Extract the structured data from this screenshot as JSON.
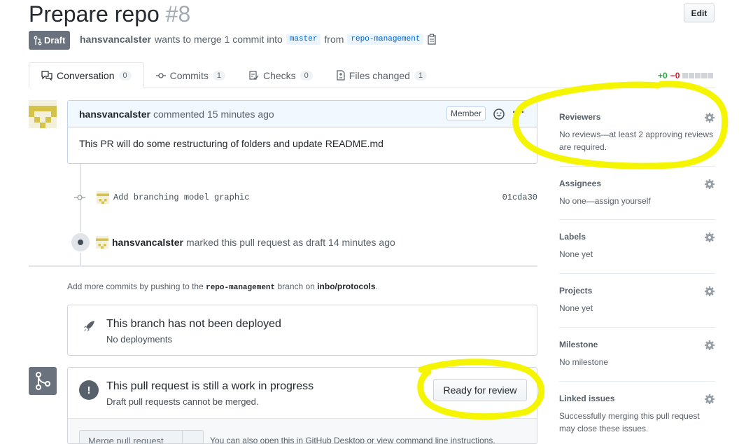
{
  "pr": {
    "title": "Prepare repo",
    "number": "#8",
    "edit_label": "Edit",
    "draft_label": "Draft",
    "author": "hansvancalster",
    "merge_text": "wants to merge 1 commit into",
    "base_branch": "master",
    "from_text": "from",
    "head_branch": "repo-management"
  },
  "tabs": [
    {
      "label": "Conversation",
      "count": "0",
      "icon": "comment-discussion-icon"
    },
    {
      "label": "Commits",
      "count": "1",
      "icon": "git-commit-icon"
    },
    {
      "label": "Checks",
      "count": "0",
      "icon": "checklist-icon"
    },
    {
      "label": "Files changed",
      "count": "1",
      "icon": "file-diff-icon"
    }
  ],
  "diffstat": {
    "additions": "+0",
    "deletions": "−0"
  },
  "comment": {
    "author": "hansvancalster",
    "action": "commented 15 minutes ago",
    "role": "Member",
    "body": "This PR will do some restructuring of folders and update README.md"
  },
  "commit": {
    "message": "Add branching model graphic",
    "sha": "01cda30"
  },
  "draft_event": {
    "author": "hansvancalster",
    "text": "marked this pull request as draft 14 minutes ago"
  },
  "push_note": {
    "prefix": "Add more commits by pushing to the",
    "branch": "repo-management",
    "middle": "branch on",
    "repo": "inbo/protocols",
    "suffix": "."
  },
  "deploy": {
    "title": "This branch has not been deployed",
    "subtitle": "No deployments"
  },
  "wip": {
    "title": "This pull request is still a work in progress",
    "subtitle": "Draft pull requests cannot be merged.",
    "ready_label": "Ready for review",
    "merge_label": "Merge pull request",
    "desktop_note": "You can also open this in GitHub Desktop or view command line instructions."
  },
  "sidebar": {
    "reviewers": {
      "title": "Reviewers",
      "text": "No reviews—at least 2 approving reviews are required."
    },
    "assignees": {
      "title": "Assignees",
      "text": "No one—assign yourself"
    },
    "labels": {
      "title": "Labels",
      "text": "None yet"
    },
    "projects": {
      "title": "Projects",
      "text": "None yet"
    },
    "milestone": {
      "title": "Milestone",
      "text": "No milestone"
    },
    "linked": {
      "title": "Linked issues",
      "text": "Successfully merging this pull request may close these issues."
    }
  },
  "colors": {
    "highlight": "#f5f500",
    "draft": "#6a737d",
    "link": "#0366d6"
  }
}
